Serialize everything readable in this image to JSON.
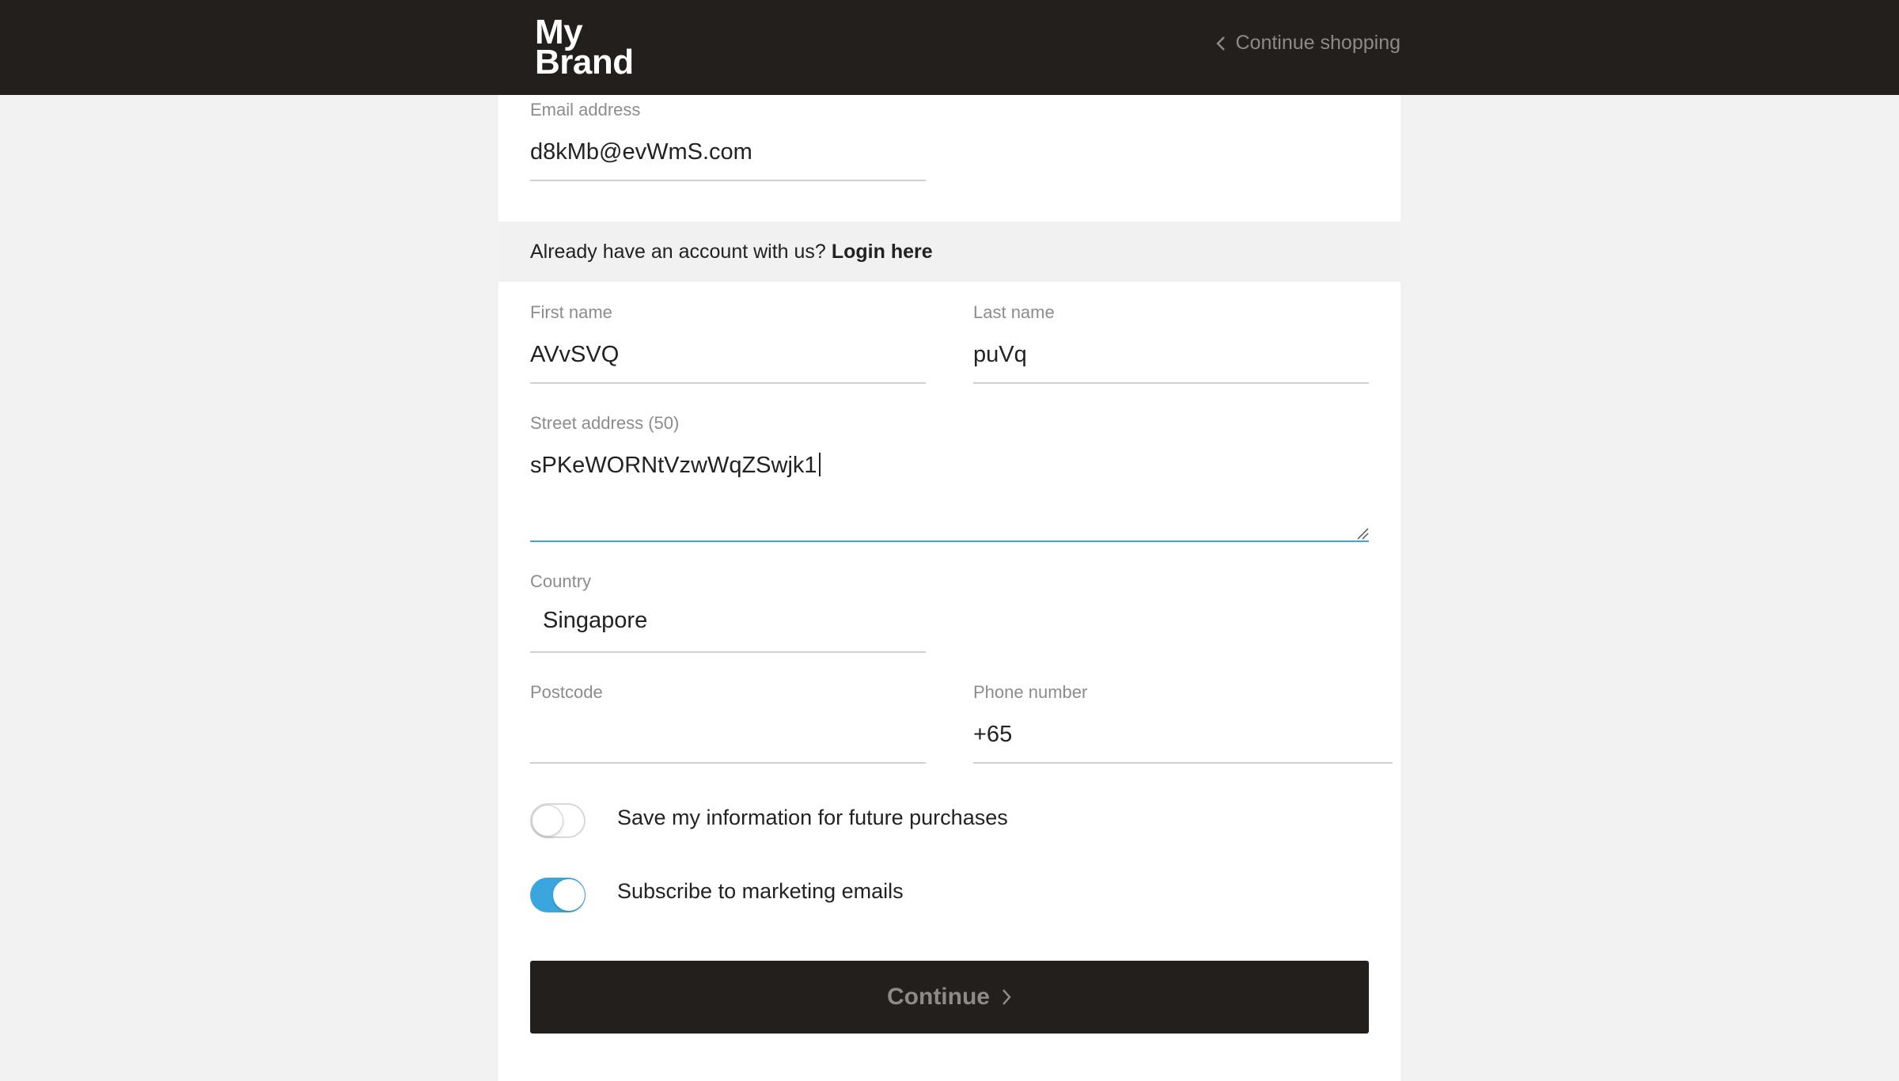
{
  "header": {
    "logo_line1": "My",
    "logo_line2": "Brand",
    "continue_shopping": "Continue shopping"
  },
  "form": {
    "email": {
      "label": "Email address",
      "value": "d8kMb@evWmS.com"
    },
    "account_prompt": "Already have an account with us?",
    "login_link": "Login here",
    "first_name": {
      "label": "First name",
      "value": "AVvSVQ"
    },
    "last_name": {
      "label": "Last name",
      "value": "puVq"
    },
    "street": {
      "label": "Street address (50)",
      "value": "sPKeWORNtVzwWqZSwjk1"
    },
    "country": {
      "label": "Country",
      "value": "Singapore"
    },
    "postcode": {
      "label": "Postcode",
      "value": ""
    },
    "phone": {
      "label": "Phone number",
      "value": "+65"
    },
    "save_info": {
      "label": "Save my information for future purchases",
      "enabled": false
    },
    "subscribe": {
      "label": "Subscribe to marketing emails",
      "enabled": true
    },
    "continue_label": "Continue"
  },
  "colors": {
    "header_bg": "#231f1c",
    "accent": "#3aa6dd",
    "button_bg": "#231f1c",
    "button_text": "#8d8a87"
  },
  "icons": {
    "back": "chevron-left-icon",
    "continue": "chevron-right-icon"
  }
}
